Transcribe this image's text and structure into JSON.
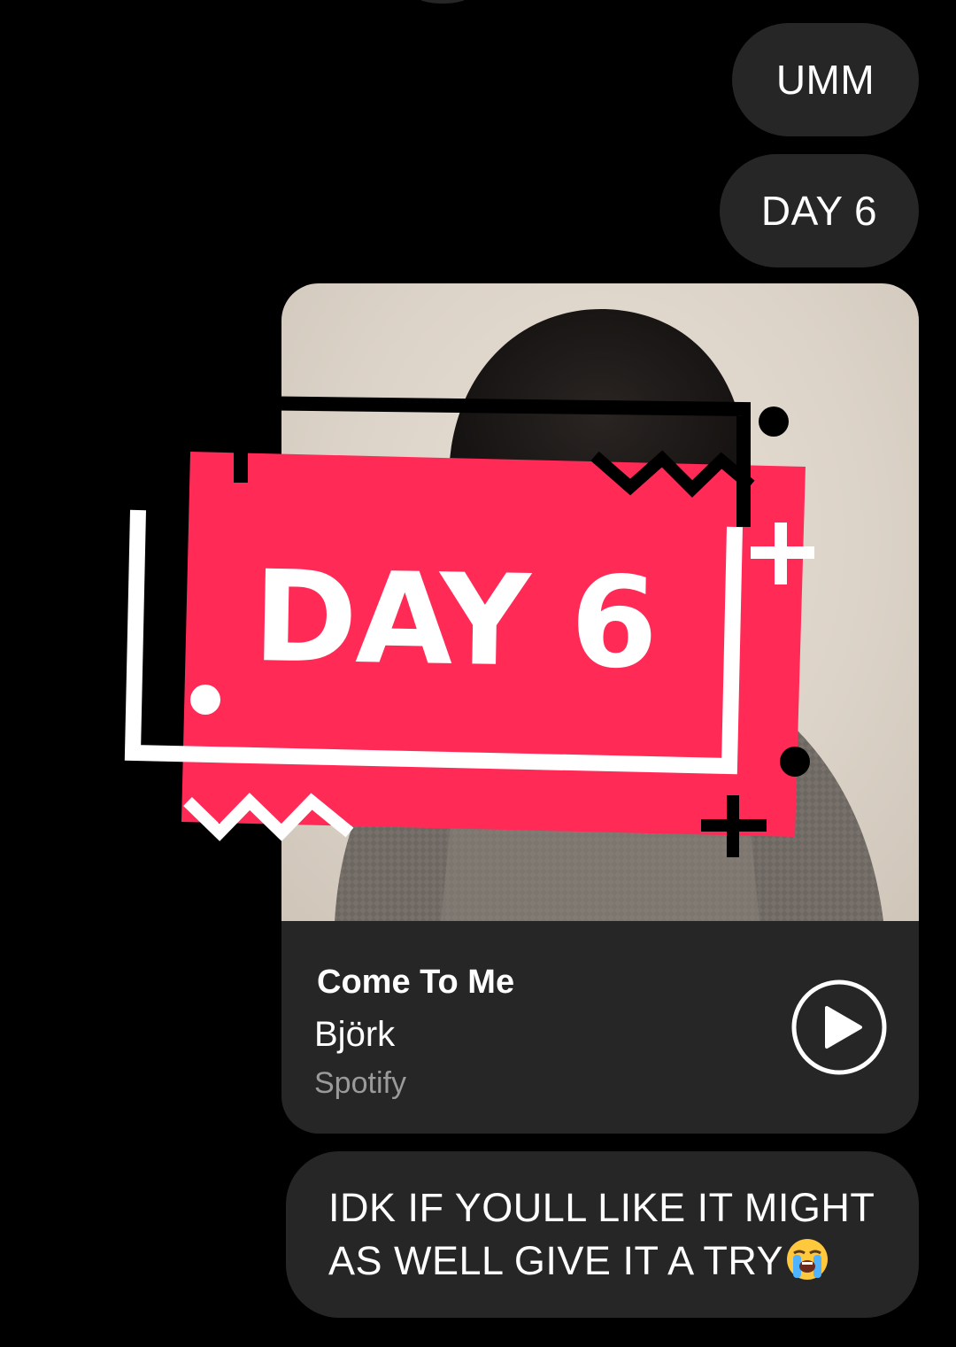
{
  "messages": [
    {
      "id": "umm",
      "text": "UMM"
    },
    {
      "id": "day6",
      "text": "DAY 6"
    },
    {
      "id": "idk",
      "text": "IDK IF YOULL LIKE IT MIGHT AS WELL GIVE IT A TRY",
      "emoji": "loudly-crying-face"
    }
  ],
  "music_card": {
    "cover_text": "DAY 6",
    "title": "Come To Me",
    "artist": "Björk",
    "source": "Spotify",
    "play_icon": "play-circle-icon"
  },
  "colors": {
    "background": "#000000",
    "bubble": "#262626",
    "banner": "#ff2b56",
    "source_text": "#9a9a9a"
  }
}
